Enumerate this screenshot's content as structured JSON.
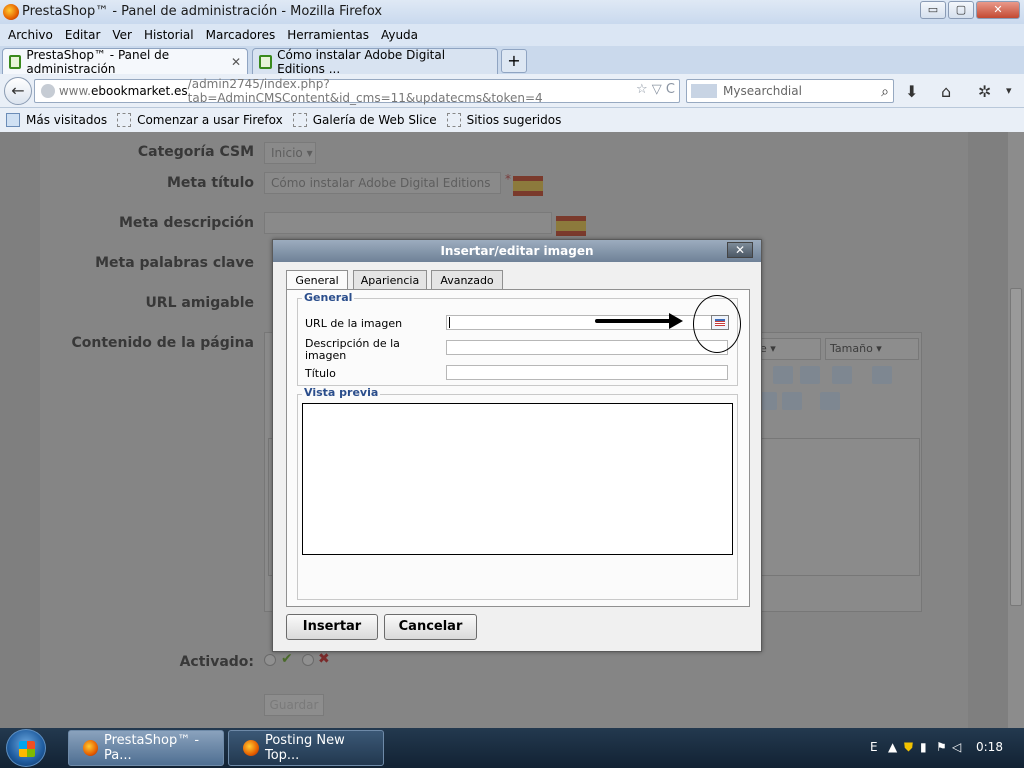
{
  "window": {
    "title": "PrestaShop™ - Panel de administración - Mozilla Firefox",
    "buttons": [
      "▭",
      "▢",
      "✕"
    ]
  },
  "menu": [
    "Archivo",
    "Editar",
    "Ver",
    "Historial",
    "Marcadores",
    "Herramientas",
    "Ayuda"
  ],
  "tabs": [
    {
      "label": "PrestaShop™ - Panel de administración",
      "close": "✕"
    },
    {
      "label": "Cómo instalar Adobe Digital Editions ..."
    }
  ],
  "newtab_label": "+",
  "nav": {
    "url_prefix": "www.",
    "url_domain": "ebookmarket.es",
    "url_path": "/admin2745/index.php?tab=AdminCMSContent&id_cms=11&updatecms&token=4",
    "url_tools": "☆ ▽ C",
    "search_placeholder": "Mysearchdial",
    "search_icon": "magnifier-icon"
  },
  "bookmarks": [
    "Más visitados",
    "Comenzar a usar Firefox",
    "Galería de Web Slice",
    "Sitios sugeridos"
  ],
  "form": {
    "categoria_label": "Categoría CSM",
    "categoria_value": "Inicio",
    "meta_titulo_label": "Meta título",
    "meta_titulo_value": "Cómo instalar Adobe Digital Editions",
    "required_mark": "*",
    "meta_descripcion_label": "Meta descripción",
    "meta_palabras_label": "Meta palabras clave",
    "url_amigable_label": "URL amigable",
    "contenido_label": "Contenido de la página",
    "tamano_select": "Tamaño",
    "activado_label": "Activado:",
    "yes_mark": "✔",
    "no_mark": "✖",
    "guardar_label": "Guardar"
  },
  "dialog": {
    "title": "Insertar/editar imagen",
    "close": "✕",
    "tabs": [
      "General",
      "Apariencia",
      "Avanzado"
    ],
    "general_legend": "General",
    "url_label": "URL de la imagen",
    "descripcion_label": "Descripción de la imagen",
    "titulo_label": "Título",
    "preview_legend": "Vista previa",
    "insert_label": "Insertar",
    "cancel_label": "Cancelar"
  },
  "taskbar": {
    "items": [
      "PrestaShop™ - Pa...",
      "Posting New Top..."
    ],
    "tray_lang": "E",
    "time": "0:18"
  }
}
